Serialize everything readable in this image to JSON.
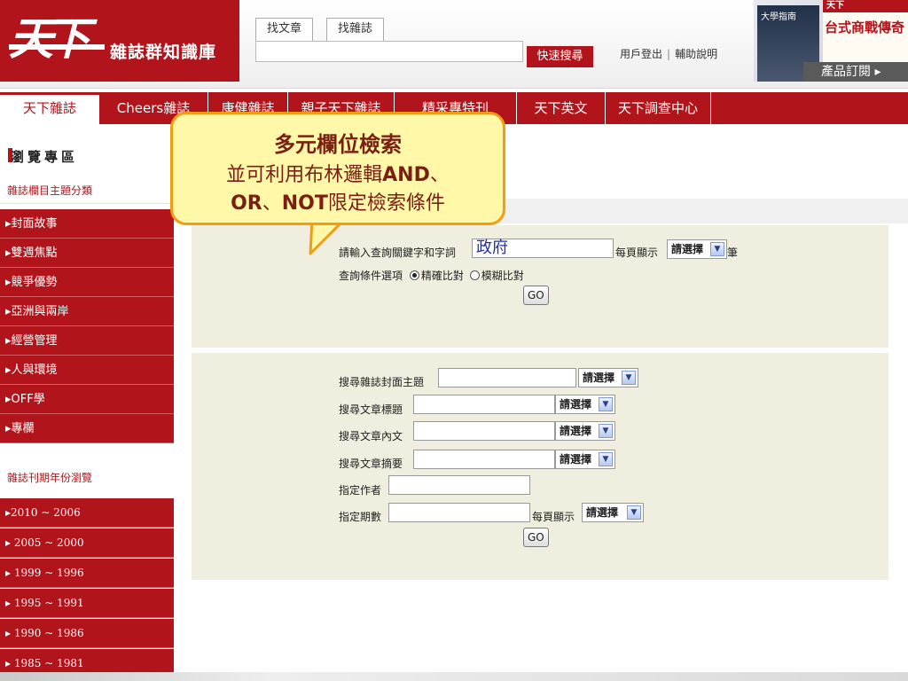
{
  "header": {
    "logo_mark": "天下",
    "logo_text": "雜誌群知識庫",
    "search_tabs": [
      "找文章",
      "找雜誌"
    ],
    "quick_search_label": "快速搜尋",
    "links": [
      "用戶登出",
      "輔助說明"
    ],
    "promo": {
      "mag1_text": "大學指南",
      "mag2_masthead": "天下",
      "mag2_headline": "台式商戰傳奇",
      "order_label": "產品訂閱 ▸"
    }
  },
  "nav": {
    "items": [
      "天下雜誌",
      "Cheers雜誌",
      "康健雜誌",
      "親子天下雜誌",
      "精采專特刊",
      "天下英文",
      "天下調查中心"
    ],
    "active": "天下雜誌"
  },
  "sidebar": {
    "browse_title": "瀏覽專區",
    "category_title": "雜誌欄目主題分類",
    "categories": [
      "▸封面故事",
      "▸雙週焦點",
      "▸競爭優勢",
      "▸亞洲與兩岸",
      "▸經營管理",
      "▸人與環境",
      "▸OFF學",
      "▸專欄"
    ],
    "year_title": "雜誌刊期年份瀏覽",
    "years": [
      "▸2010 ~ 2006",
      "▸ 2005 ~ 2000",
      "▸ 1999 ~ 1996",
      "▸ 1995 ~ 1991",
      "▸ 1990 ~ 1986",
      "▸ 1985 ~ 1981"
    ]
  },
  "quick_form": {
    "keyword_label": "請輸入查詢關鍵字和字詞",
    "keyword_value": "政府",
    "per_page_label": "每頁顯示",
    "per_page_select": "請選擇",
    "per_page_unit": "筆",
    "option_label": "查詢條件選項",
    "exact_label": "精確比對",
    "fuzzy_label": "模糊比對",
    "go_label": "GO"
  },
  "advanced_form": {
    "fields": [
      {
        "label": "搜尋雜誌封面主題",
        "select": "請選擇"
      },
      {
        "label": "搜尋文章標題",
        "select": "請選擇"
      },
      {
        "label": "搜尋文章內文",
        "select": "請選擇"
      },
      {
        "label": "搜尋文章摘要",
        "select": "請選擇"
      }
    ],
    "author_label": "指定作者",
    "issue_label": "指定期數",
    "per_page_label": "每頁顯示",
    "per_page_select": "請選擇",
    "go_label": "GO"
  },
  "callout": {
    "title": "多元欄位檢索",
    "line1_pre": "並可利用布林邏輯",
    "line1_bold": "AND",
    "line1_post": "、",
    "line2_bold1": "OR",
    "line2_mid": "、",
    "line2_bold2": "NOT",
    "line2_post": "限定檢索條件"
  },
  "colors": {
    "brand_red": "#b1141b",
    "callout_fill": "#fff8a8",
    "callout_border": "#f39c12",
    "panel_bg": "#f0eedf"
  }
}
